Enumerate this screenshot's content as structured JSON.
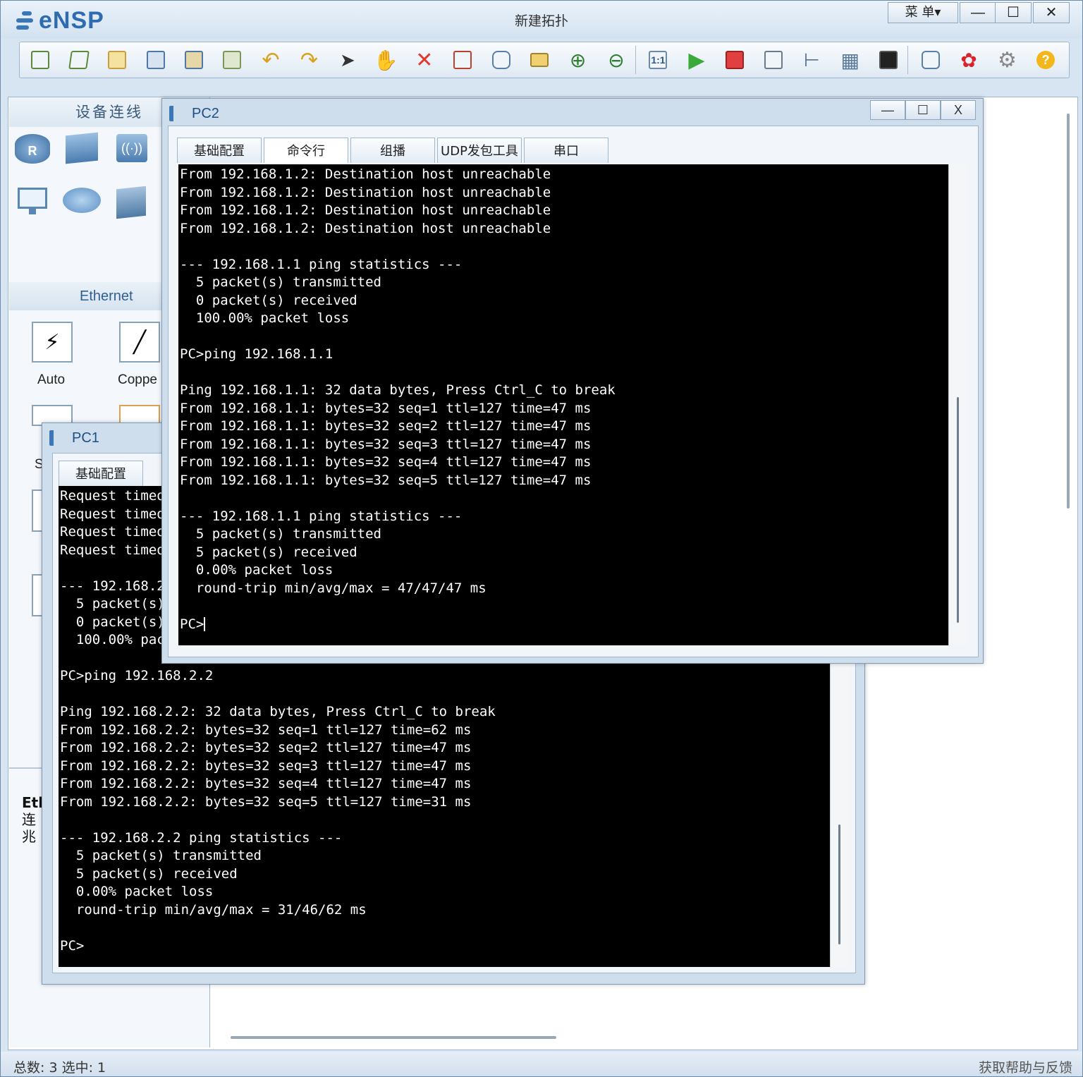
{
  "app": {
    "name": "eNSP",
    "document_title": "新建拓扑",
    "menu_label": "菜 单▾",
    "minimize": "—",
    "maximize": "☐",
    "close": "✕"
  },
  "toolbar": {
    "icons": [
      "new-topology-icon",
      "new-example-icon",
      "open-icon",
      "save-icon",
      "save-as-icon",
      "print-icon",
      "undo-icon",
      "redo-icon",
      "select-pointer-icon",
      "hand-pan-icon",
      "delete-icon",
      "delete-link-icon",
      "text-note-icon",
      "rectangle-icon",
      "zoom-in-icon",
      "zoom-out-icon",
      "fit-size-icon",
      "start-device-icon",
      "stop-device-icon",
      "capture-icon",
      "topology-icon",
      "grid-icon",
      "terminal-icon",
      "forum-icon",
      "huawei-icon",
      "settings-icon",
      "help-icon"
    ]
  },
  "sidebar": {
    "title": "设备连线",
    "section_title": "Ethernet",
    "cables": [
      {
        "label": "Auto"
      },
      {
        "label": "Coppe"
      }
    ],
    "info_title": "Etl",
    "info_line1": "连",
    "info_line2": "兆",
    "partial_s": "S"
  },
  "pc2": {
    "title": "PC2",
    "tabs": [
      "基础配置",
      "命令行",
      "组播",
      "UDP发包工具",
      "串口"
    ],
    "active_tab": "命令行",
    "terminal_lines": [
      "From 192.168.1.2: Destination host unreachable",
      "From 192.168.1.2: Destination host unreachable",
      "From 192.168.1.2: Destination host unreachable",
      "From 192.168.1.2: Destination host unreachable",
      "",
      "--- 192.168.1.1 ping statistics ---",
      "  5 packet(s) transmitted",
      "  0 packet(s) received",
      "  100.00% packet loss",
      "",
      "PC>ping 192.168.1.1",
      "",
      "Ping 192.168.1.1: 32 data bytes, Press Ctrl_C to break",
      "From 192.168.1.1: bytes=32 seq=1 ttl=127 time=47 ms",
      "From 192.168.1.1: bytes=32 seq=2 ttl=127 time=47 ms",
      "From 192.168.1.1: bytes=32 seq=3 ttl=127 time=47 ms",
      "From 192.168.1.1: bytes=32 seq=4 ttl=127 time=47 ms",
      "From 192.168.1.1: bytes=32 seq=5 ttl=127 time=47 ms",
      "",
      "--- 192.168.1.1 ping statistics ---",
      "  5 packet(s) transmitted",
      "  5 packet(s) received",
      "  0.00% packet loss",
      "  round-trip min/avg/max = 47/47/47 ms",
      ""
    ],
    "prompt": "PC>"
  },
  "pc1": {
    "title": "PC1",
    "tabs": [
      "基础配置"
    ],
    "terminal_lines": [
      "Request timeout!",
      "Request timeout!",
      "Request timeout!",
      "Request timeout!",
      "",
      "--- 192.168.2.2 ping statistics ---",
      "  5 packet(s) transmitted",
      "  0 packet(s) received",
      "  100.00% packet loss",
      "",
      "PC>ping 192.168.2.2",
      "",
      "Ping 192.168.2.2: 32 data bytes, Press Ctrl_C to break",
      "From 192.168.2.2: bytes=32 seq=1 ttl=127 time=62 ms",
      "From 192.168.2.2: bytes=32 seq=2 ttl=127 time=47 ms",
      "From 192.168.2.2: bytes=32 seq=3 ttl=127 time=47 ms",
      "From 192.168.2.2: bytes=32 seq=4 ttl=127 time=47 ms",
      "From 192.168.2.2: bytes=32 seq=5 ttl=127 time=31 ms",
      "",
      "--- 192.168.2.2 ping statistics ---",
      "  5 packet(s) transmitted",
      "  5 packet(s) received",
      "  0.00% packet loss",
      "  round-trip min/avg/max = 31/46/62 ms",
      "",
      "PC>"
    ]
  },
  "statusbar": {
    "left": "总数: 3  选中: 1",
    "right": "获取帮助与反馈"
  },
  "colors": {
    "accent": "#2e6cb0",
    "terminal_bg": "#000000",
    "terminal_fg": "#ffffff",
    "frame": "#cfdeed"
  }
}
